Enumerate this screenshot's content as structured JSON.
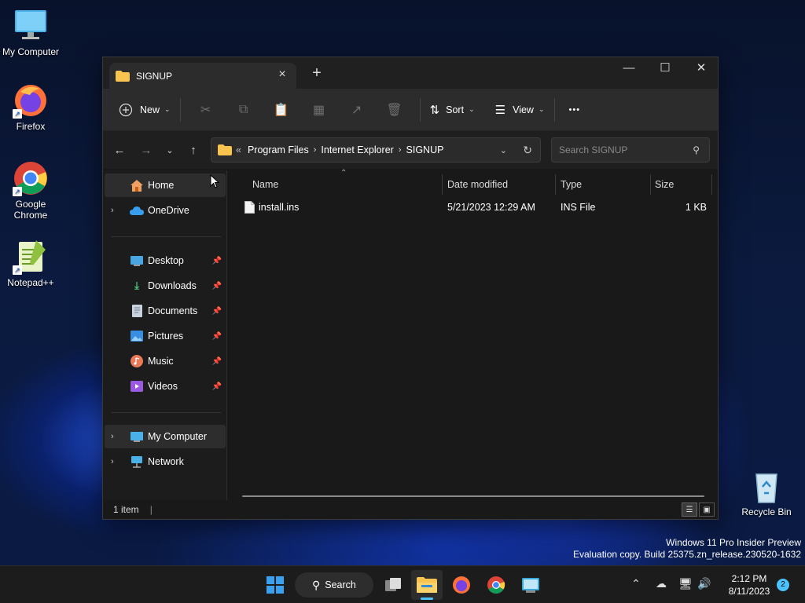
{
  "desktop": {
    "icons": [
      {
        "label": "My Computer"
      },
      {
        "label": "Firefox"
      },
      {
        "label": "Google Chrome"
      },
      {
        "label": "Notepad++"
      },
      {
        "label": "Recycle Bin"
      }
    ]
  },
  "window": {
    "tab_title": "SIGNUP",
    "toolbar": {
      "new_label": "New",
      "sort_label": "Sort",
      "view_label": "View",
      "more_label": "•••"
    },
    "breadcrumb": {
      "overflow": "«",
      "parts": [
        "Program Files",
        "Internet Explorer",
        "SIGNUP"
      ]
    },
    "search": {
      "placeholder": "Search SIGNUP"
    },
    "sidebar": {
      "home": "Home",
      "onedrive": "OneDrive",
      "quick_access": [
        "Desktop",
        "Downloads",
        "Documents",
        "Pictures",
        "Music",
        "Videos"
      ],
      "my_computer": "My Computer",
      "network": "Network"
    },
    "columns": {
      "name": "Name",
      "date": "Date modified",
      "type": "Type",
      "size": "Size"
    },
    "files": [
      {
        "name": "install.ins",
        "date": "5/21/2023 12:29 AM",
        "type": "INS File",
        "size": "1 KB"
      }
    ],
    "status": {
      "item_count": "1 item"
    }
  },
  "watermark": {
    "line1": "Windows 11 Pro Insider Preview",
    "line2": "Evaluation copy. Build 25375.zn_release.230520-1632"
  },
  "taskbar": {
    "search_label": "Search",
    "time": "2:12 PM",
    "date": "8/11/2023",
    "notification_count": "2"
  },
  "colors": {
    "accent": "#4cc2ff",
    "folder": "#f8c44f",
    "window_bg": "#191919",
    "toolbar_bg": "#2c2c2c"
  }
}
